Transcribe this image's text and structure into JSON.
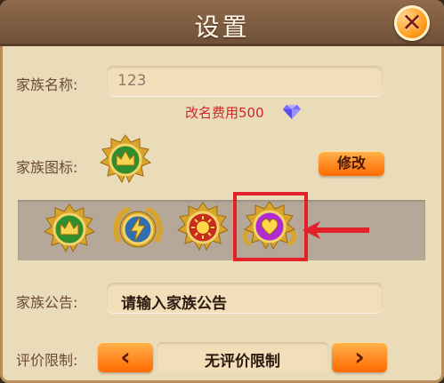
{
  "header": {
    "title": "设置",
    "close_label": "✕"
  },
  "family_name": {
    "label": "家族名称:",
    "value": "123"
  },
  "rename_cost": {
    "text": "改名费用500",
    "icon": "diamond-icon",
    "icon_color": "#7a6cff"
  },
  "family_icon": {
    "label": "家族图标:",
    "edit_label": "修改"
  },
  "emblems": [
    {
      "name": "crown-emblem",
      "selected": false
    },
    {
      "name": "lightning-emblem",
      "selected": false
    },
    {
      "name": "sun-emblem",
      "selected": false
    },
    {
      "name": "heart-emblem",
      "selected": true
    }
  ],
  "notice": {
    "label": "家族公告:",
    "placeholder": "请输入家族公告"
  },
  "evaluation": {
    "label": "评价限制:",
    "value": "无评价限制",
    "prev_glyph": "‹",
    "next_glyph": "›"
  },
  "colors": {
    "accent": "#ff7a10",
    "panel": "#eadbb9",
    "header": "#7a5a40",
    "highlight_red": "#e4202a"
  }
}
